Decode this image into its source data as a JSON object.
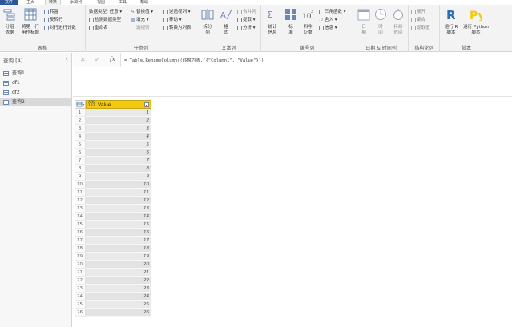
{
  "tabs": {
    "file": "文件",
    "home": "主页",
    "transform": "转换",
    "add_column": "添加列",
    "view": "视图",
    "tools": "工具",
    "help": "帮助"
  },
  "ribbon": {
    "table": {
      "label": "表格",
      "group_by": "分组\n依据",
      "first_row_header": "将第一行\n用作标题",
      "transpose": "转置",
      "reverse_rows": "反转行",
      "count_rows": "对行进行计数"
    },
    "any_column": {
      "label": "任意列",
      "data_type": "数据类型: 任意",
      "detect_type": "检测数据类型",
      "rename": "重命名",
      "replace_values": "替换值",
      "fill": "填充",
      "pivot_column": "透视列",
      "unpivot_columns": "逆透视列",
      "move": "移动",
      "convert_to_list": "转换为列表"
    },
    "text_column": {
      "label": "文本列",
      "split_column": "拆分\n列",
      "format": "格\n式",
      "merge_columns": "合并列",
      "extract": "提取",
      "parse": "分析"
    },
    "number_column": {
      "label": "编号列",
      "statistics": "统计\n信息",
      "standard": "标\n准",
      "scientific": "科学\n记数",
      "trigonometry": "三角函数",
      "rounding": "舍入",
      "information": "信息"
    },
    "datetime_column": {
      "label": "日期 & 时间列",
      "date": "日\n期",
      "time": "时\n间",
      "duration": "持续\n时间"
    },
    "structured_column": {
      "label": "结构化列",
      "expand": "展开",
      "aggregate": "聚合",
      "extract_values": "提取值"
    },
    "scripts": {
      "label": "脚本",
      "run_r": "运行 R\n脚本",
      "run_python": "运行 Python\n脚本"
    }
  },
  "query_pane": {
    "header": "查询 [4]",
    "items": [
      {
        "label": "查询1"
      },
      {
        "label": "df1"
      },
      {
        "label": "df2"
      },
      {
        "label": "查询2"
      }
    ]
  },
  "formula_bar": {
    "fx": "fx",
    "formula": "= Table.RenameColumns(转换为表,{{\"Column1\", \"Value\"}})"
  },
  "grid": {
    "column_header": "Value",
    "type_icon": "ABC\n123",
    "rows": [
      {
        "n": "1",
        "v": "1"
      },
      {
        "n": "2",
        "v": "2"
      },
      {
        "n": "3",
        "v": "3"
      },
      {
        "n": "4",
        "v": "4"
      },
      {
        "n": "5",
        "v": "5"
      },
      {
        "n": "6",
        "v": "6"
      },
      {
        "n": "7",
        "v": "7"
      },
      {
        "n": "8",
        "v": "8"
      },
      {
        "n": "9",
        "v": "9"
      },
      {
        "n": "10",
        "v": "10"
      },
      {
        "n": "11",
        "v": "11"
      },
      {
        "n": "12",
        "v": "12"
      },
      {
        "n": "13",
        "v": "13"
      },
      {
        "n": "14",
        "v": "14"
      },
      {
        "n": "15",
        "v": "15"
      },
      {
        "n": "16",
        "v": "16"
      },
      {
        "n": "17",
        "v": "17"
      },
      {
        "n": "18",
        "v": "18"
      },
      {
        "n": "19",
        "v": "19"
      },
      {
        "n": "20",
        "v": "20"
      },
      {
        "n": "21",
        "v": "21"
      },
      {
        "n": "22",
        "v": "22"
      },
      {
        "n": "23",
        "v": "23"
      },
      {
        "n": "24",
        "v": "24"
      },
      {
        "n": "25",
        "v": "25"
      },
      {
        "n": "26",
        "v": "26"
      }
    ]
  },
  "colors": {
    "file_tab": "#2b579a",
    "column_header": "#f2c811",
    "selected_query": "#d9d9d9"
  }
}
